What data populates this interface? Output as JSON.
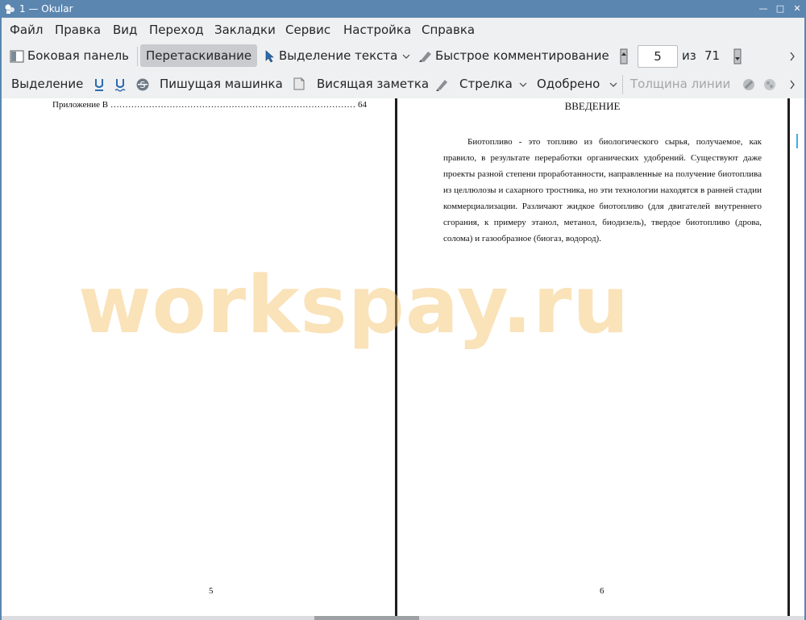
{
  "window": {
    "title": "1  — Okular"
  },
  "menu": [
    "Файл",
    "Правка",
    "Вид",
    "Переход",
    "Закладки",
    "Сервис",
    "Настройка",
    "Справка"
  ],
  "toolbar1": {
    "sidebar_label": "Боковая панель",
    "drag_label": "Перетаскивание",
    "select_text_label": "Выделение текста",
    "quick_comment_label": "Быстрое комментирование",
    "page_value": "5",
    "of_label": "из",
    "total_pages": "71"
  },
  "toolbar2": {
    "selection_label": "Выделение",
    "typewriter_label": "Пишущая машинка",
    "hanging_note_label": "Висящая заметка",
    "arrow_label": "Стрелка",
    "approved_label": "Одобрено",
    "line_width_label": "Толщина линии"
  },
  "left_page": {
    "toc_entry": "Приложение В ……………………………………………………………………………………………………………………………",
    "toc_page": "64",
    "page_number": "5"
  },
  "right_page": {
    "title": "ВВЕДЕНИЕ",
    "body": "Биотопливо - это топливо из биологического сырья, получаемое, как правило, в результате переработки органических удобрений. Существуют даже проекты разной степени проработанности, направленные на получение биотоплива из целлюлозы и сахарного тростника, но эти технологии находятся в ранней стадии коммерциализации. Различают жидкое биотопливо (для двигателей внутреннего сгорания, к примеру этанол, метанол, биодизель), твердое биотопливо (дрова, солома) и газообразное (биогаз, водород).",
    "page_number": "6"
  },
  "watermark": "workspay.ru",
  "colors": {
    "titlebar": "#5b86b0",
    "accent": "#3daee9",
    "toolbar_bg": "#eff0f1"
  }
}
